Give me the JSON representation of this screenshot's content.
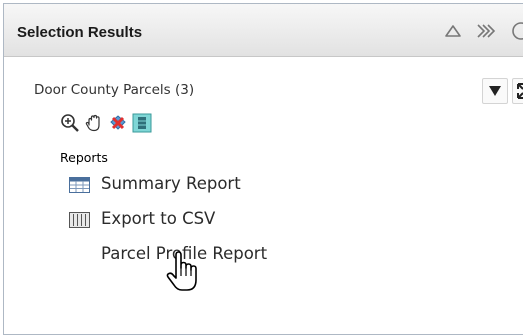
{
  "panel": {
    "title": "Selection Results",
    "header_icons": [
      "collapse-up-icon",
      "double-chevron-right-icon",
      "close-icon"
    ]
  },
  "layer": {
    "title": "Door County Parcels (3)",
    "menu_icon": "dropdown-triangle-icon",
    "expand_icon": "expand-icon"
  },
  "tools": [
    "zoom-in-icon",
    "pan-hand-icon",
    "clear-selection-icon",
    "table-icon"
  ],
  "reports": {
    "label": "Reports",
    "items": [
      {
        "label": "Summary Report",
        "icon": "summary-table-icon"
      },
      {
        "label": "Export to CSV",
        "icon": "csv-grid-icon"
      },
      {
        "label": "Parcel Profile Report",
        "icon": ""
      }
    ]
  },
  "colors": {
    "header_top": "#f7f7f7",
    "header_bottom": "#e2e2e2",
    "border": "#aeb8c4",
    "text": "#2b2b2b"
  }
}
